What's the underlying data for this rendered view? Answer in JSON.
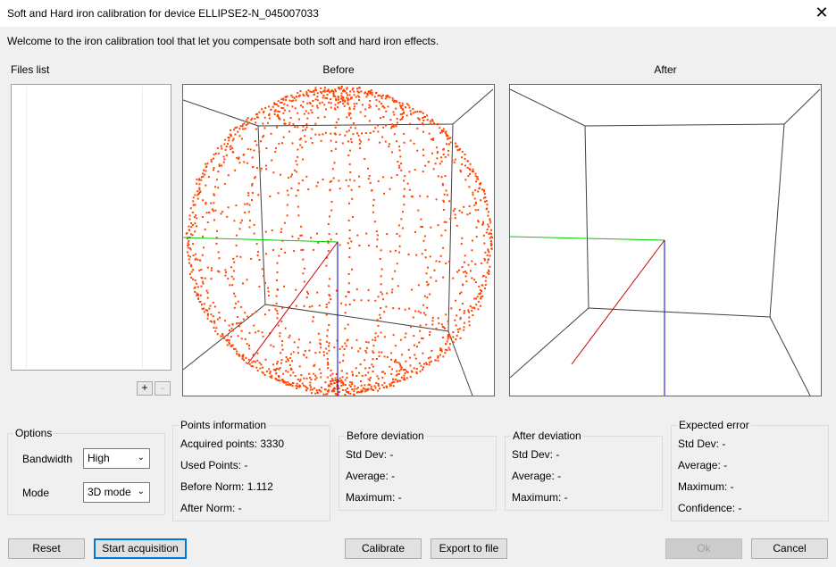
{
  "window": {
    "title": "Soft and Hard iron calibration for device ELLIPSE2-N_045007033",
    "close_glyph": "✕"
  },
  "welcome": "Welcome to the iron calibration tool that let you compensate both soft and hard iron effects.",
  "files_list": {
    "label": "Files list",
    "add": "+",
    "remove": "-"
  },
  "views": {
    "before_label": "Before",
    "after_label": "After"
  },
  "colors": {
    "points": "#ff4500",
    "axis_x": "#00cc00",
    "axis_y": "#cc0000",
    "axis_z": "#0000cc",
    "focus": "#0078d7"
  },
  "options": {
    "title": "Options",
    "bandwidth_label": "Bandwidth",
    "bandwidth_value": "High",
    "mode_label": "Mode",
    "mode_value": "3D mode"
  },
  "points_info": {
    "title": "Points information",
    "acquired": "Acquired points: 3330",
    "used": "Used Points: -",
    "before_norm": "Before Norm: 1.112",
    "after_norm": "After Norm: -"
  },
  "before_dev": {
    "title": "Before deviation",
    "std": "Std Dev: -",
    "avg": "Average: -",
    "max": "Maximum: -"
  },
  "after_dev": {
    "title": "After deviation",
    "std": "Std Dev: -",
    "avg": "Average: -",
    "max": "Maximum: -"
  },
  "expected": {
    "title": "Expected error",
    "std": "Std Dev: -",
    "avg": "Average: -",
    "max": "Maximum: -",
    "conf": "Confidence: -"
  },
  "buttons": {
    "reset": "Reset",
    "start": "Start acquisition",
    "calibrate": "Calibrate",
    "export": "Export to file",
    "ok": "Ok",
    "cancel": "Cancel"
  }
}
